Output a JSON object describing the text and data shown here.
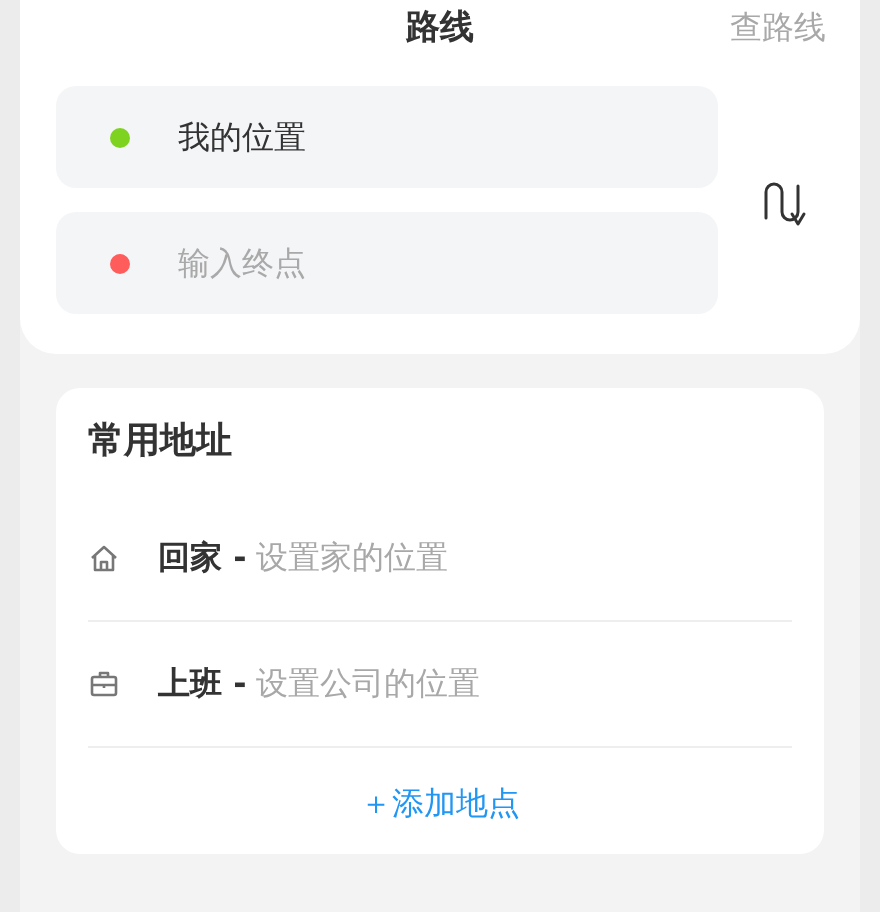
{
  "header": {
    "title": "路线",
    "action": "查路线"
  },
  "route": {
    "start": {
      "value": "我的位置",
      "color": "#7ed321"
    },
    "end": {
      "placeholder": "输入终点",
      "color": "#ff5c5c"
    }
  },
  "favorites": {
    "title": "常用地址",
    "items": [
      {
        "kind": "home",
        "label": "回家 -",
        "hint": "设置家的位置"
      },
      {
        "kind": "work",
        "label": "上班 -",
        "hint": "设置公司的位置"
      }
    ],
    "add_link": "＋添加地点"
  }
}
